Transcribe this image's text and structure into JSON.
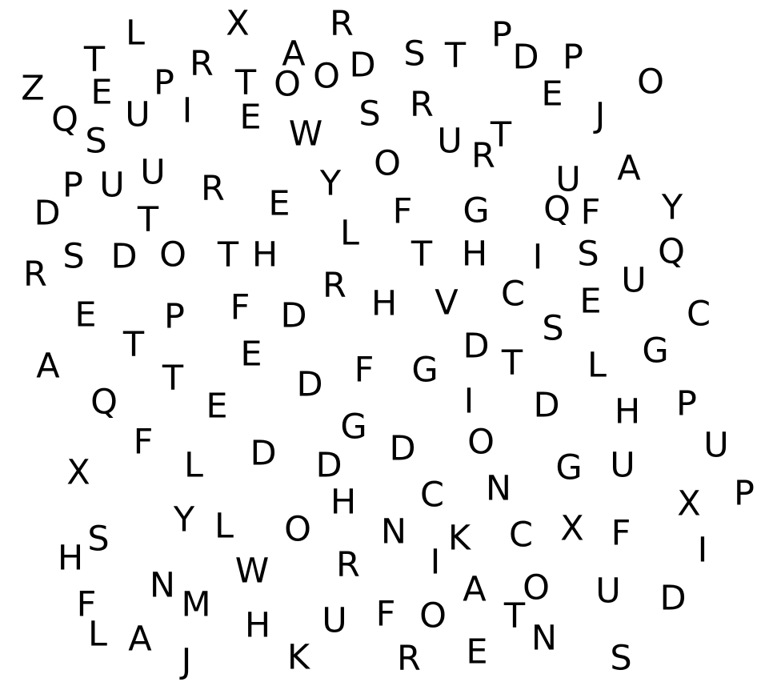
{
  "letters": [
    "X",
    "R",
    "L",
    "A",
    "S",
    "T",
    "P",
    "T",
    "R",
    "D",
    "D",
    "P",
    "O",
    "O",
    "T",
    "P",
    "O",
    "Z",
    "E",
    "E",
    "I",
    "E",
    "S",
    "R",
    "Q",
    "U",
    "J",
    "T",
    "W",
    "S",
    "U",
    "R",
    "O",
    "U",
    "U",
    "A",
    "P",
    "R",
    "U",
    "Y",
    "E",
    "F",
    "G",
    "Q",
    "F",
    "Y",
    "D",
    "T",
    "L",
    "O",
    "T",
    "H",
    "T",
    "H",
    "I",
    "S",
    "Q",
    "S",
    "D",
    "R",
    "U",
    "R",
    "H",
    "V",
    "C",
    "C",
    "E",
    "F",
    "D",
    "E",
    "P",
    "S",
    "T",
    "D",
    "E",
    "G",
    "T",
    "F",
    "A",
    "G",
    "D",
    "L",
    "T",
    "I",
    "Q",
    "E",
    "D",
    "P",
    "H",
    "G",
    "F",
    "O",
    "U",
    "D",
    "D",
    "U",
    "X",
    "D",
    "G",
    "L",
    "C",
    "N",
    "X",
    "P",
    "H",
    "Y",
    "L",
    "O",
    "N",
    "K",
    "X",
    "C",
    "F",
    "S",
    "H",
    "I",
    "I",
    "W",
    "R",
    "N",
    "A",
    "O",
    "U",
    "D",
    "M",
    "F",
    "O",
    "T",
    "H",
    "U",
    "F",
    "L",
    "A",
    "N",
    "S",
    "K",
    "R",
    "E",
    "J"
  ]
}
